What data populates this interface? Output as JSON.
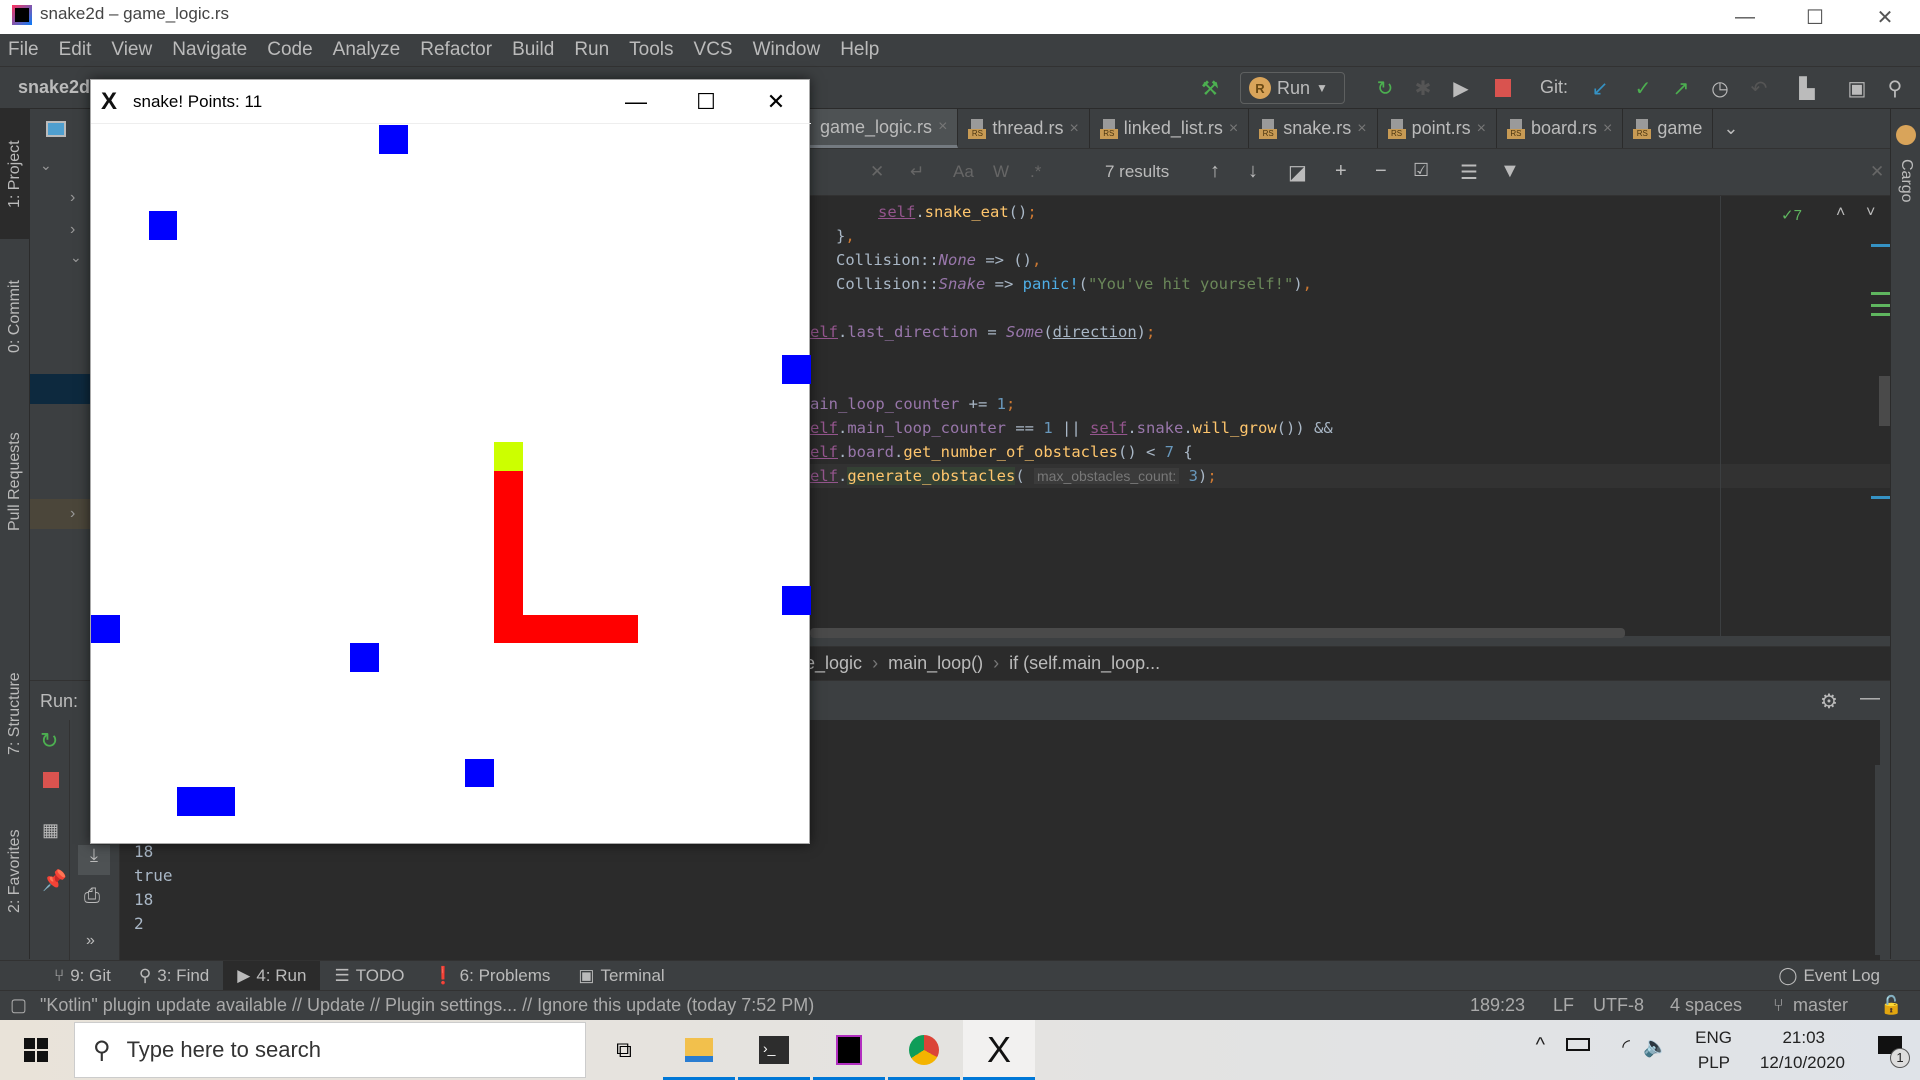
{
  "window": {
    "title": "snake2d – game_logic.rs",
    "controls": {
      "minimize": "—",
      "maximize": "☐",
      "close": "✕"
    }
  },
  "menubar": {
    "items": [
      "File",
      "Edit",
      "View",
      "Navigate",
      "Code",
      "Analyze",
      "Refactor",
      "Build",
      "Run",
      "Tools",
      "VCS",
      "Window",
      "Help"
    ]
  },
  "navbar": {
    "project": "snake2d",
    "run_config": "Run",
    "git_label": "Git:"
  },
  "left_strip": {
    "tabs": [
      "1: Project",
      "0: Commit",
      "Pull Requests",
      "7: Structure",
      "2: Favorites"
    ]
  },
  "project_panel": {
    "header": "Project"
  },
  "editor_tabs": [
    {
      "label": "game_logic.rs",
      "active": true
    },
    {
      "label": "thread.rs",
      "active": false
    },
    {
      "label": "linked_list.rs",
      "active": false
    },
    {
      "label": "snake.rs",
      "active": false
    },
    {
      "label": "point.rs",
      "active": false
    },
    {
      "label": "board.rs",
      "active": false
    },
    {
      "label": "game",
      "active": false
    }
  ],
  "search": {
    "results": "7 results",
    "options": [
      "Aa",
      "W",
      ".*"
    ]
  },
  "editor": {
    "inspection_count": "7",
    "lines": [
      "self.snake_eat();",
      "},",
      "Collision::None => (),",
      "Collision::Snake => panic!(\"You've hit yourself!\"),",
      "",
      "self.last_direction = Some(direction);",
      "",
      "",
      "self.main_loop_counter += 1;",
      "if (self.main_loop_counter == 1 || self.snake.will_grow()) &&",
      "self.board.get_number_of_obstacles() < 7 {",
      "self.generate_obstacles( max_obstacles_count: 3);"
    ],
    "param_hint": "max_obstacles_count:"
  },
  "breadcrumb": [
    "game_logic",
    "main_loop()",
    "if (self.main_loop..."
  ],
  "run_panel": {
    "label": "Run:",
    "console_lines": [
      "18",
      "true",
      "18",
      "2"
    ]
  },
  "right_strip": {
    "tabs": [
      "Cargo"
    ]
  },
  "bottom_tabs": [
    {
      "label": "9: Git",
      "icon": "git-branch-icon"
    },
    {
      "label": "3: Find",
      "icon": "search-icon"
    },
    {
      "label": "4: Run",
      "icon": "run-icon",
      "active": true
    },
    {
      "label": "TODO",
      "icon": "list-icon"
    },
    {
      "label": "6: Problems",
      "icon": "warning-icon"
    },
    {
      "label": "Terminal",
      "icon": "terminal-icon"
    }
  ],
  "event_log": "Event Log",
  "statusbar": {
    "message": "\"Kotlin\" plugin update available // Update // Plugin settings... // Ignore this update (today 7:52 PM)",
    "position": "189:23",
    "line_sep": "LF",
    "encoding": "UTF-8",
    "indent": "4 spaces",
    "branch": "master"
  },
  "taskbar": {
    "search_placeholder": "Type here to search",
    "lang_top": "ENG",
    "lang_bottom": "PLP",
    "time": "21:03",
    "date": "12/10/2020",
    "notifications": "1"
  },
  "snake_window": {
    "title": "snake! Points: 11",
    "points": 11,
    "grid_size": 25,
    "colors": {
      "obstacle": "#0000ff",
      "snake_body": "#ff0000",
      "snake_head": "#ccff00",
      "background": "#ffffff"
    },
    "obstacles": [
      [
        10,
        0
      ],
      [
        2,
        3
      ],
      [
        24,
        8
      ],
      [
        24,
        16
      ],
      [
        0,
        17
      ],
      [
        9,
        18
      ],
      [
        13,
        22
      ],
      [
        3,
        23
      ],
      [
        4,
        23
      ]
    ],
    "snake_head": [
      14,
      11
    ],
    "snake_body": [
      [
        14,
        12
      ],
      [
        14,
        13
      ],
      [
        14,
        14
      ],
      [
        14,
        15
      ],
      [
        14,
        16
      ],
      [
        14,
        17
      ],
      [
        15,
        17
      ],
      [
        16,
        17
      ],
      [
        17,
        17
      ],
      [
        18,
        17
      ]
    ]
  }
}
